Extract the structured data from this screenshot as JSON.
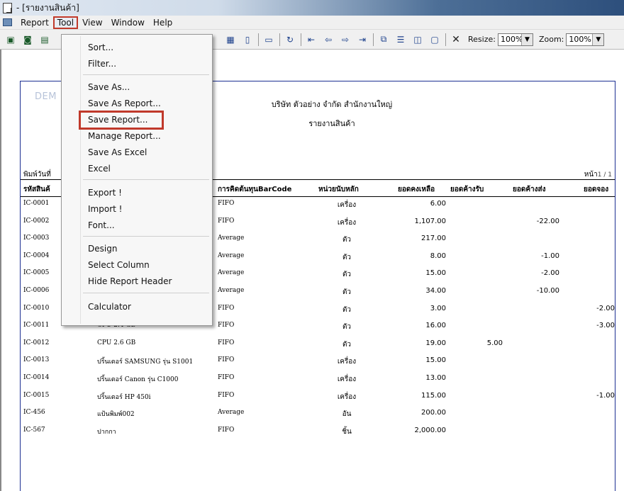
{
  "window": {
    "title": "- [รายงานสินค้า]"
  },
  "menubar": {
    "items": [
      "Report",
      "Tool",
      "View",
      "Window",
      "Help"
    ],
    "active": "Tool"
  },
  "toolbar": {
    "resize_label": "Resize:",
    "resize_value": "100%",
    "zoom_label": "Zoom:",
    "zoom_value": "100%",
    "close_glyph": "✕"
  },
  "tool_menu": {
    "items": [
      "Sort...",
      "Filter...",
      "Save As...",
      "Save As Report...",
      "Save Report...",
      "Manage Report...",
      "Save As Excel",
      "Excel",
      "Export !",
      "Import !",
      "Font...",
      "Design",
      "Select Column",
      "Hide Report Header",
      "Calculator"
    ],
    "highlighted": "Save Report...",
    "highlight_color": "#c0392b"
  },
  "report": {
    "watermark": "DEM",
    "company": "บริษัท ตัวอย่าง จำกัด   สำนักงานใหญ่",
    "title": "รายงานสินค้า",
    "print_date_label": "พิมพ์วันที่",
    "page_label": "หน้า",
    "page_value": "1 / 1",
    "columns": {
      "code": "รหัสสินค้",
      "method": "การคิดต้นทุนBarCode",
      "unit": "หน่วยนับหลัก",
      "balance": "ยอดคงเหลือ",
      "receive": "ยอดค้างรับ",
      "ship": "ยอดค้างส่ง",
      "book": "ยอดจอง"
    },
    "rows": [
      {
        "code": "IC-0001",
        "name": "",
        "method": "FIFO",
        "unit": "เครื่อง",
        "balance": "6.00",
        "receive": "",
        "ship": "",
        "book": ""
      },
      {
        "code": "IC-0002",
        "name": "",
        "method": "FIFO",
        "unit": "เครื่อง",
        "balance": "1,107.00",
        "receive": "",
        "ship": "-22.00",
        "book": ""
      },
      {
        "code": "IC-0003",
        "name": "",
        "method": "Average",
        "unit": "ตัว",
        "balance": "217.00",
        "receive": "",
        "ship": "",
        "book": ""
      },
      {
        "code": "IC-0004",
        "name": "",
        "method": "Average",
        "unit": "ตัว",
        "balance": "8.00",
        "receive": "",
        "ship": "-1.00",
        "book": ""
      },
      {
        "code": "IC-0005",
        "name": "",
        "method": "Average",
        "unit": "ตัว",
        "balance": "15.00",
        "receive": "",
        "ship": "-2.00",
        "book": ""
      },
      {
        "code": "IC-0006",
        "name": "",
        "method": "Average",
        "unit": "ตัว",
        "balance": "34.00",
        "receive": "",
        "ship": "-10.00",
        "book": ""
      },
      {
        "code": "IC-0010",
        "name": "CPU  2.0 GB",
        "method": "FIFO",
        "unit": "ตัว",
        "balance": "3.00",
        "receive": "",
        "ship": "",
        "book": "-2.00"
      },
      {
        "code": "IC-0011",
        "name": "CPU  2.4 GB",
        "method": "FIFO",
        "unit": "ตัว",
        "balance": "16.00",
        "receive": "",
        "ship": "",
        "book": "-3.00"
      },
      {
        "code": "IC-0012",
        "name": "CPU  2.6 GB",
        "method": "FIFO",
        "unit": "ตัว",
        "balance": "19.00",
        "receive": "5.00",
        "ship": "",
        "book": ""
      },
      {
        "code": "IC-0013",
        "name": "ปริ้นเตอร์ SAMSUNG  รุ่น S1001",
        "method": "FIFO",
        "unit": "เครื่อง",
        "balance": "15.00",
        "receive": "",
        "ship": "",
        "book": ""
      },
      {
        "code": "IC-0014",
        "name": "ปริ้นเตอร์ Canon  รุ่น C1000",
        "method": "FIFO",
        "unit": "เครื่อง",
        "balance": "13.00",
        "receive": "",
        "ship": "",
        "book": ""
      },
      {
        "code": "IC-0015",
        "name": "ปริ้นเตอร์ HP  450i",
        "method": "FIFO",
        "unit": "เครื่อง",
        "balance": "115.00",
        "receive": "",
        "ship": "",
        "book": "-1.00"
      },
      {
        "code": "IC-456",
        "name": "แป้นพิมพ์002",
        "method": "Average",
        "unit": "อัน",
        "balance": "200.00",
        "receive": "",
        "ship": "",
        "book": ""
      },
      {
        "code": "IC-567",
        "name": "ปากกา",
        "method": "FIFO",
        "unit": "ชิ้น",
        "balance": "2,000.00",
        "receive": "",
        "ship": "",
        "book": ""
      }
    ]
  }
}
